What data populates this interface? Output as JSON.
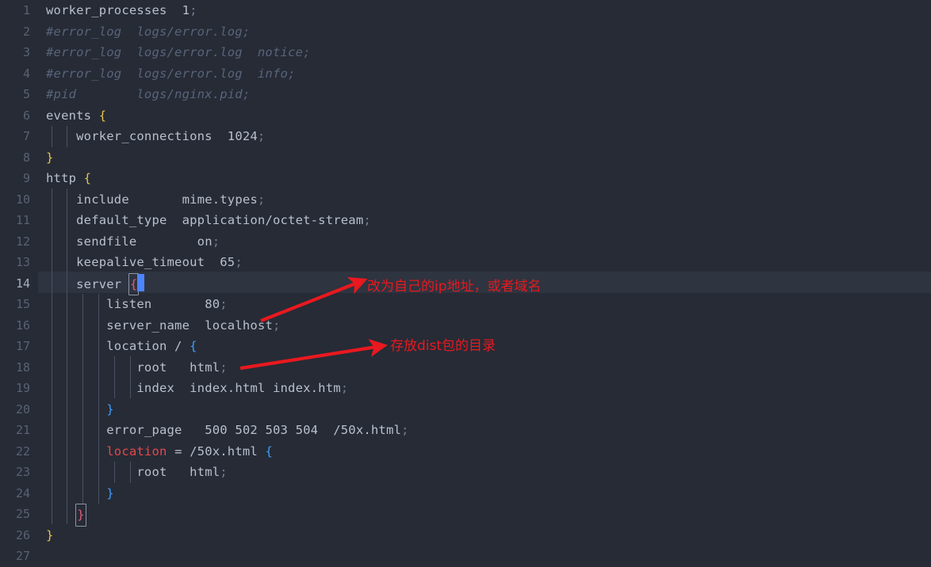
{
  "editor": {
    "name": "nginx-conf-editor",
    "background_color": "#262b36",
    "active_line_number": 14,
    "total_lines": 27,
    "gutter_numbers": [
      "1",
      "2",
      "3",
      "4",
      "5",
      "6",
      "7",
      "8",
      "9",
      "10",
      "11",
      "12",
      "13",
      "14",
      "15",
      "16",
      "17",
      "18",
      "19",
      "20",
      "21",
      "22",
      "23",
      "24",
      "25",
      "26",
      "27"
    ],
    "lines": [
      {
        "n": "1",
        "text": "worker_processes  1;"
      },
      {
        "n": "2",
        "text": "#error_log  logs/error.log;"
      },
      {
        "n": "3",
        "text": "#error_log  logs/error.log  notice;"
      },
      {
        "n": "4",
        "text": "#error_log  logs/error.log  info;"
      },
      {
        "n": "5",
        "text": "#pid        logs/nginx.pid;"
      },
      {
        "n": "6",
        "text": "events {"
      },
      {
        "n": "7",
        "text": "    worker_connections  1024;"
      },
      {
        "n": "8",
        "text": "}"
      },
      {
        "n": "9",
        "text": "http {"
      },
      {
        "n": "10",
        "text": "    include       mime.types;"
      },
      {
        "n": "11",
        "text": "    default_type  application/octet-stream;"
      },
      {
        "n": "12",
        "text": "    sendfile        on;"
      },
      {
        "n": "13",
        "text": "    keepalive_timeout  65;"
      },
      {
        "n": "14",
        "text": "    server {"
      },
      {
        "n": "15",
        "text": "        listen       80;"
      },
      {
        "n": "16",
        "text": "        server_name  localhost;"
      },
      {
        "n": "17",
        "text": "        location / {"
      },
      {
        "n": "18",
        "text": "            root   html;"
      },
      {
        "n": "19",
        "text": "            index  index.html index.htm;"
      },
      {
        "n": "20",
        "text": "        }"
      },
      {
        "n": "21",
        "text": "        error_page   500 502 503 504  /50x.html;"
      },
      {
        "n": "22",
        "text": "        location = /50x.html {"
      },
      {
        "n": "23",
        "text": "            root   html;"
      },
      {
        "n": "24",
        "text": "        }"
      },
      {
        "n": "25",
        "text": "    }"
      },
      {
        "n": "26",
        "text": "}"
      },
      {
        "n": "27",
        "text": ""
      }
    ]
  },
  "tokens": {
    "l1_key": "worker_processes",
    "l1_sp": "  ",
    "l1_val": "1",
    "l1_semi": ";",
    "l2": "#error_log  logs/error.log;",
    "l3": "#error_log  logs/error.log  notice;",
    "l4": "#error_log  logs/error.log  info;",
    "l5": "#pid        logs/nginx.pid;",
    "l6_key": "events ",
    "l6_brace": "{",
    "l7_key": "    worker_connections",
    "l7_sp": "  ",
    "l7_val": "1024",
    "l7_semi": ";",
    "l8_brace": "}",
    "l9_key": "http ",
    "l9_brace": "{",
    "l10_key": "    include",
    "l10_sp": "       ",
    "l10_val": "mime.types",
    "l10_semi": ";",
    "l11_key": "    default_type",
    "l11_sp": "  ",
    "l11_val": "application/octet-stream",
    "l11_semi": ";",
    "l12_key": "    sendfile",
    "l12_sp": "        ",
    "l12_val": "on",
    "l12_semi": ";",
    "l13_key": "    keepalive_timeout",
    "l13_sp": "  ",
    "l13_val": "65",
    "l13_semi": ";",
    "l14_key": "    server ",
    "l14_brace": "{",
    "l15_key": "        listen",
    "l15_sp": "       ",
    "l15_val": "80",
    "l15_semi": ";",
    "l16_key": "        server_name",
    "l16_sp": "  ",
    "l16_val": "localhost",
    "l16_semi": ";",
    "l17_key": "        location / ",
    "l17_brace": "{",
    "l18_key": "            root",
    "l18_sp": "   ",
    "l18_val": "html",
    "l18_semi": ";",
    "l19_key": "            index",
    "l19_sp": "  ",
    "l19_val": "index.html index.htm",
    "l19_semi": ";",
    "l20_brace": "        }",
    "l21_key": "        error_page",
    "l21_sp": "   ",
    "l21_val": "500 502 503 504  /50x.html",
    "l21_semi": ";",
    "l22_kw": "location",
    "l22_mid": " = /50x.html ",
    "l22_indent": "        ",
    "l22_brace": "{",
    "l23_key": "            root",
    "l23_sp": "   ",
    "l23_val": "html",
    "l23_semi": ";",
    "l24_brace": "        }",
    "l25_indent": "    ",
    "l25_brace": "}",
    "l26_brace": "}"
  },
  "annotations": {
    "color": "#e8191f",
    "items": [
      {
        "id": "annotation-server-name",
        "text": "改为自己的ip地址，或者域名",
        "points_to_line": 16,
        "points_to_token": "localhost"
      },
      {
        "id": "annotation-root-dir",
        "text": "存放dist包的目录",
        "points_to_line": 18,
        "points_to_token": "html"
      }
    ]
  },
  "caret": {
    "line": 14,
    "column": 12,
    "color": "#4d84ff"
  }
}
